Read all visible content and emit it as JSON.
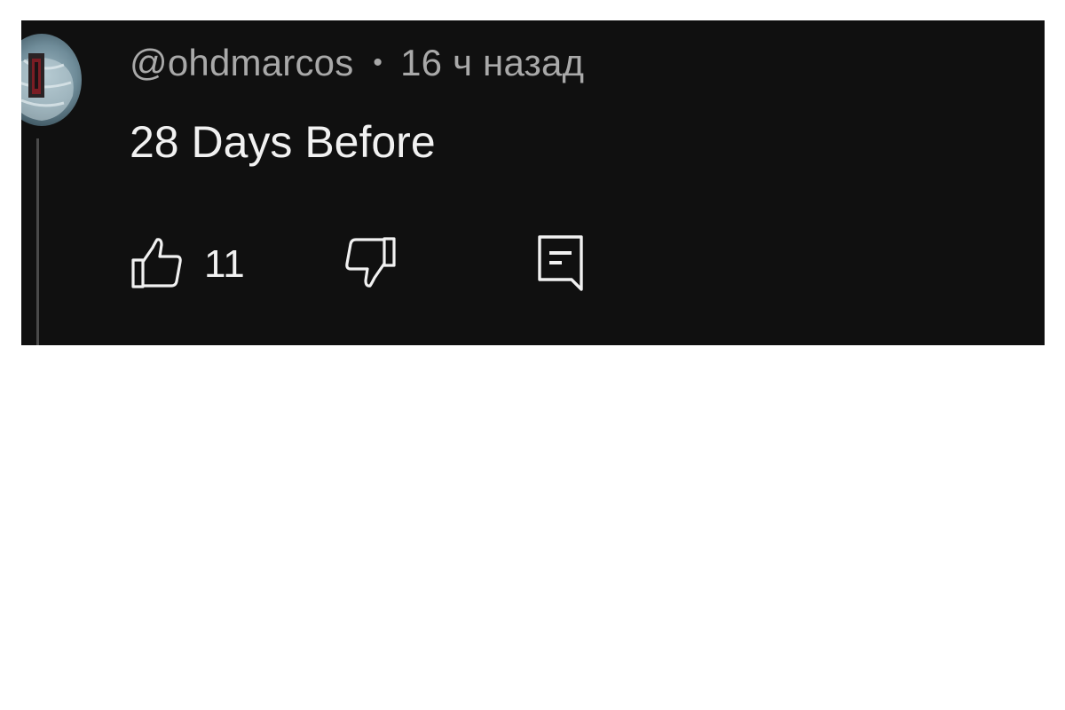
{
  "comment": {
    "author": "@ohdmarcos",
    "separator": "•",
    "timestamp": "16 ч назад",
    "text": "28 Days Before",
    "like_count": "11"
  },
  "icons": {
    "like": "thumbs-up-icon",
    "dislike": "thumbs-down-icon",
    "reply": "comment-reply-icon"
  },
  "colors": {
    "background": "#101010",
    "text_primary": "#f1f1f1",
    "text_secondary": "#a9a9a9"
  }
}
